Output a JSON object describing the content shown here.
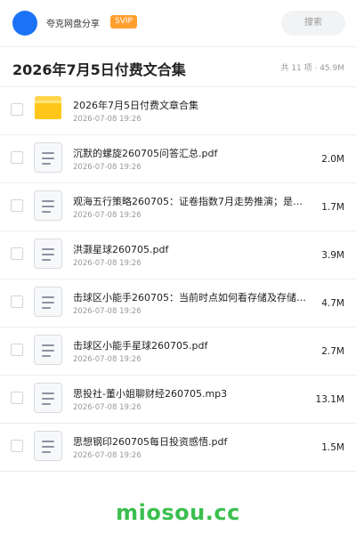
{
  "app": {
    "username": "夸克网盘分享",
    "badge": "SVIP",
    "search_label": "搜索"
  },
  "folder": {
    "title": "2026年7月5日付费文合集",
    "meta": "共 11 项 · 45.9M"
  },
  "files": [
    {
      "name": "2026年7月5日付费文章合集",
      "date": "2026-07-08 19:26",
      "size": "",
      "type": "folder"
    },
    {
      "name": "沉默的螺旋260705问答汇总.pdf",
      "date": "2026-07-08 19:26",
      "size": "2.0M",
      "type": "file"
    },
    {
      "name": "观海五行策略260705：证卷指数7月走势推演；是…",
      "date": "2026-07-08 19:26",
      "size": "1.7M",
      "type": "file"
    },
    {
      "name": "洪灏星球260705.pdf",
      "date": "2026-07-08 19:26",
      "size": "3.9M",
      "type": "file"
    },
    {
      "name": "击球区小能手260705：当前时点如何看存储及存储…",
      "date": "2026-07-08 19:26",
      "size": "4.7M",
      "type": "file"
    },
    {
      "name": "击球区小能手星球260705.pdf",
      "date": "2026-07-08 19:26",
      "size": "2.7M",
      "type": "file"
    },
    {
      "name": "思投社-董小姐聊财经260705.mp3",
      "date": "2026-07-08 19:26",
      "size": "13.1M",
      "type": "file"
    },
    {
      "name": "思想钢印260705每日投资感悟.pdf",
      "date": "2026-07-08 19:26",
      "size": "1.5M",
      "type": "file"
    }
  ],
  "watermark": "miosou.cc"
}
